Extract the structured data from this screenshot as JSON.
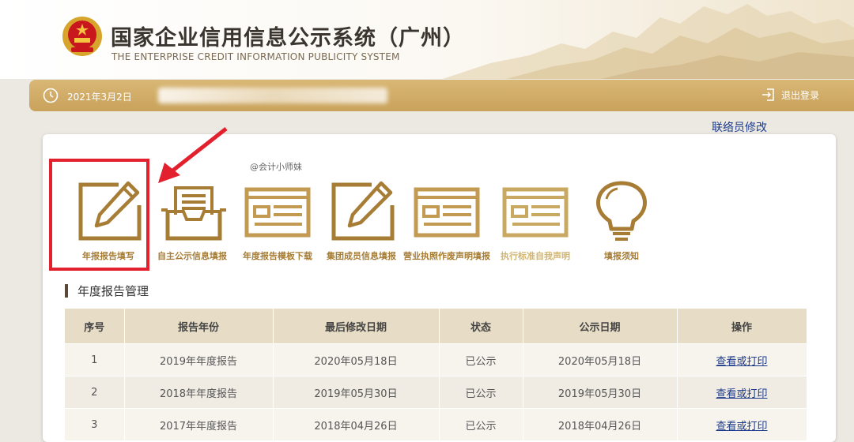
{
  "header": {
    "title_cn": "国家企业信用信息公示系统（广州）",
    "title_en": "THE ENTERPRISE CREDIT INFORMATION PUBLICITY SYSTEM"
  },
  "topbar": {
    "date": "2021年3月2日",
    "logout_label": "退出登录"
  },
  "liaison_link": "联络员修改",
  "watermark": "@会计小师妹",
  "tiles": [
    {
      "label": "年报报告填写",
      "icon": "edit-document-icon"
    },
    {
      "label": "自主公示信息填报",
      "icon": "inbox-tray-icon"
    },
    {
      "label": "年度报告模板下载",
      "icon": "template-document-icon"
    },
    {
      "label": "集团成员信息填报",
      "icon": "edit-document-icon"
    },
    {
      "label": "营业执照作废声明填报",
      "icon": "template-document-icon"
    },
    {
      "label": "执行标准自我声明",
      "icon": "template-document-icon"
    },
    {
      "label": "填报须知",
      "icon": "lightbulb-icon"
    }
  ],
  "section_title": "年度报告管理",
  "table": {
    "headers": [
      "序号",
      "报告年份",
      "最后修改日期",
      "状态",
      "公示日期",
      "操作"
    ],
    "rows": [
      [
        "1",
        "2019年年度报告",
        "2020年05月18日",
        "已公示",
        "2020年05月18日",
        "查看或打印"
      ],
      [
        "2",
        "2018年年度报告",
        "2019年05月30日",
        "已公示",
        "2019年05月30日",
        "查看或打印"
      ],
      [
        "3",
        "2017年年度报告",
        "2018年04月26日",
        "已公示",
        "2018年04月26日",
        "查看或打印"
      ]
    ]
  },
  "colors": {
    "gold": "#a77d35",
    "bar": "#c9a25b",
    "highlight": "#e3202d",
    "link": "#1d3b8a"
  }
}
